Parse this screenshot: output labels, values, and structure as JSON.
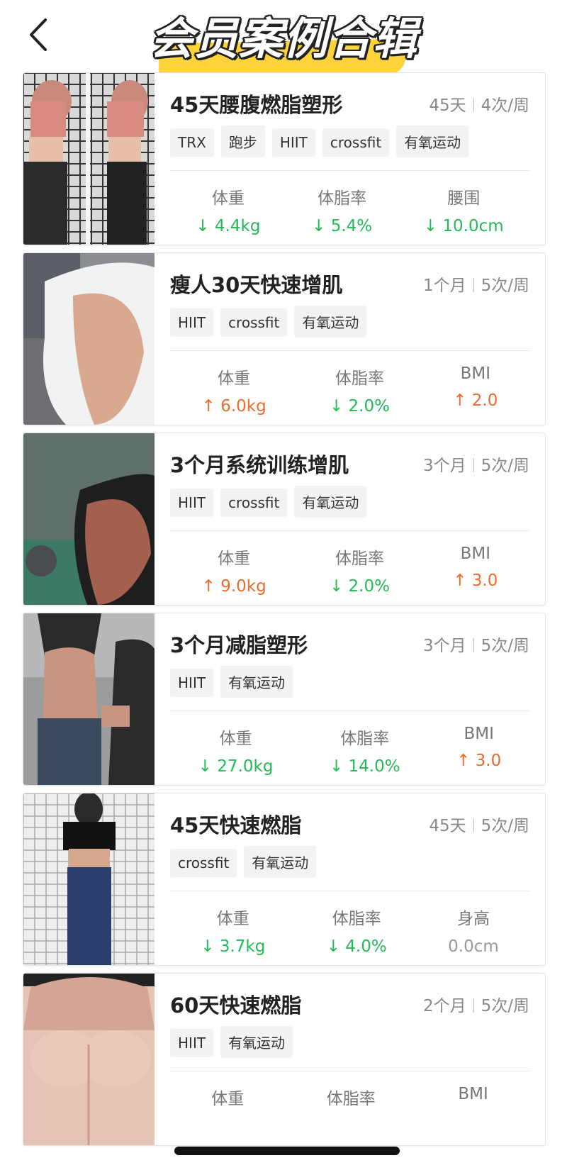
{
  "header": {
    "title": "会员案例合辑",
    "back_icon": "chevron-left-icon",
    "highlight_color": "#fcd33a"
  },
  "colors": {
    "decrease": "#22bb55",
    "increase": "#f06a2e",
    "neutral": "#999999"
  },
  "cards": [
    {
      "title": "45天腰腹燃脂塑形",
      "duration": "45天",
      "frequency": "4次/周",
      "tags": [
        "TRX",
        "跑步",
        "HIIT",
        "crossfit",
        "有氧运动"
      ],
      "stats": [
        {
          "label": "体重",
          "arrow": "↓",
          "value": "4.4kg",
          "direction": "down"
        },
        {
          "label": "体脂率",
          "arrow": "↓",
          "value": "5.4%",
          "direction": "down"
        },
        {
          "label": "腰围",
          "arrow": "↓",
          "value": "10.0cm",
          "direction": "down"
        }
      ]
    },
    {
      "title": "瘦人30天快速增肌",
      "duration": "1个月",
      "frequency": "5次/周",
      "tags": [
        "HIIT",
        "crossfit",
        "有氧运动"
      ],
      "stats": [
        {
          "label": "体重",
          "arrow": "↑",
          "value": "6.0kg",
          "direction": "up"
        },
        {
          "label": "体脂率",
          "arrow": "↓",
          "value": "2.0%",
          "direction": "down"
        },
        {
          "label": "BMI",
          "arrow": "↑",
          "value": "2.0",
          "direction": "up"
        }
      ]
    },
    {
      "title": "3个月系统训练增肌",
      "duration": "3个月",
      "frequency": "5次/周",
      "tags": [
        "HIIT",
        "crossfit",
        "有氧运动"
      ],
      "stats": [
        {
          "label": "体重",
          "arrow": "↑",
          "value": "9.0kg",
          "direction": "up"
        },
        {
          "label": "体脂率",
          "arrow": "↓",
          "value": "2.0%",
          "direction": "down"
        },
        {
          "label": "BMI",
          "arrow": "↑",
          "value": "3.0",
          "direction": "up"
        }
      ]
    },
    {
      "title": "3个月减脂塑形",
      "duration": "3个月",
      "frequency": "5次/周",
      "tags": [
        "HIIT",
        "有氧运动"
      ],
      "stats": [
        {
          "label": "体重",
          "arrow": "↓",
          "value": "27.0kg",
          "direction": "down"
        },
        {
          "label": "体脂率",
          "arrow": "↓",
          "value": "14.0%",
          "direction": "down"
        },
        {
          "label": "BMI",
          "arrow": "↑",
          "value": "3.0",
          "direction": "up"
        }
      ]
    },
    {
      "title": "45天快速燃脂",
      "duration": "45天",
      "frequency": "5次/周",
      "tags": [
        "crossfit",
        "有氧运动"
      ],
      "stats": [
        {
          "label": "体重",
          "arrow": "↓",
          "value": "3.7kg",
          "direction": "down"
        },
        {
          "label": "体脂率",
          "arrow": "↓",
          "value": "4.0%",
          "direction": "down"
        },
        {
          "label": "身高",
          "arrow": "",
          "value": "0.0cm",
          "direction": "none"
        }
      ]
    },
    {
      "title": "60天快速燃脂",
      "duration": "2个月",
      "frequency": "5次/周",
      "tags": [
        "HIIT",
        "有氧运动"
      ],
      "stats": [
        {
          "label": "体重",
          "arrow": "",
          "value": "",
          "direction": "none"
        },
        {
          "label": "体脂率",
          "arrow": "",
          "value": "",
          "direction": "none"
        },
        {
          "label": "BMI",
          "arrow": "",
          "value": "",
          "direction": "none"
        }
      ]
    }
  ]
}
